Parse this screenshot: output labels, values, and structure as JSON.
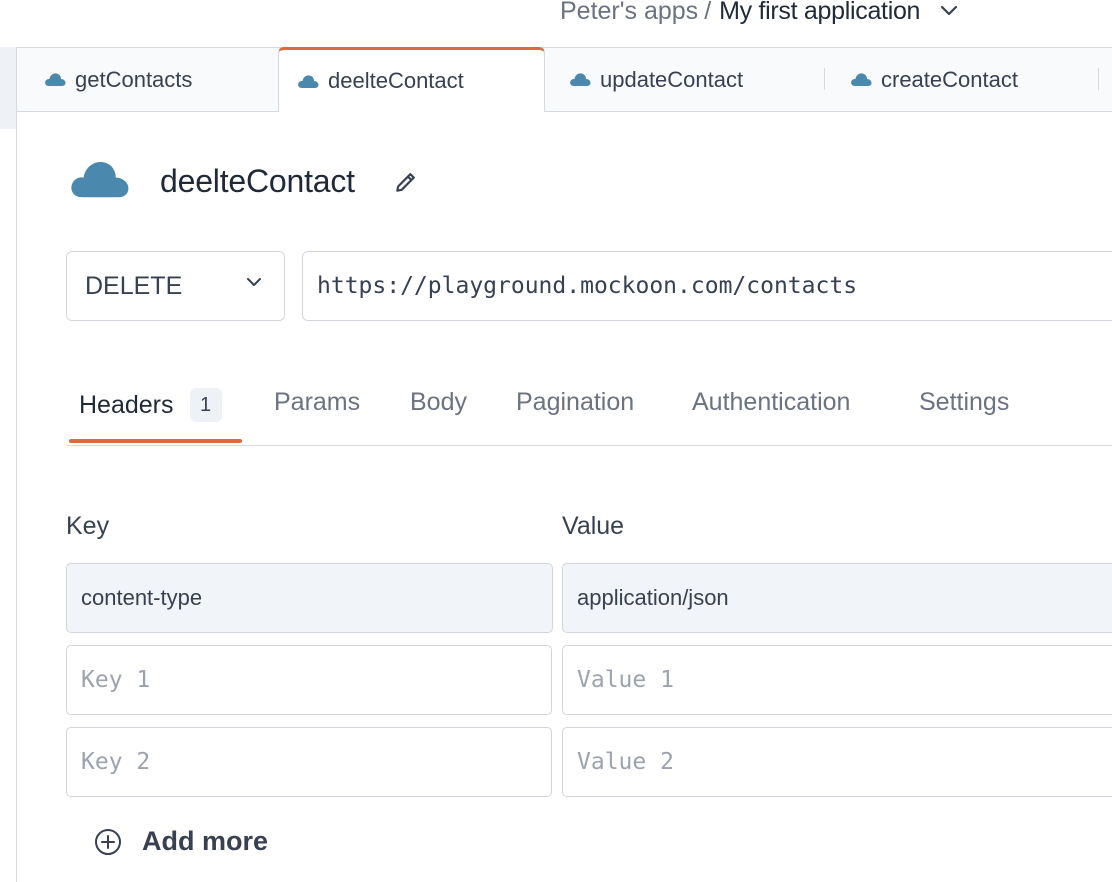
{
  "breadcrumb": {
    "root": "Peter's apps",
    "separator": "/",
    "app": "My first application",
    "dropdown_icon": "chevron-down-icon"
  },
  "tabs": [
    {
      "label": "getContacts",
      "icon": "cloud-icon",
      "active": false
    },
    {
      "label": "deelteContact",
      "icon": "cloud-icon",
      "active": true
    },
    {
      "label": "updateContact",
      "icon": "cloud-icon",
      "active": false
    },
    {
      "label": "createContact",
      "icon": "cloud-icon",
      "active": false
    }
  ],
  "endpoint": {
    "name": "deelteContact",
    "icon": "cloud-icon",
    "edit_icon": "pencil-icon",
    "method": "DELETE",
    "url": "https://playground.mockoon.com/contacts"
  },
  "sub_tabs": [
    {
      "label": "Headers",
      "badge": "1",
      "active": true
    },
    {
      "label": "Params",
      "active": false
    },
    {
      "label": "Body",
      "active": false
    },
    {
      "label": "Pagination",
      "active": false
    },
    {
      "label": "Authentication",
      "active": false
    },
    {
      "label": "Settings",
      "active": false
    }
  ],
  "headers_table": {
    "key_label": "Key",
    "value_label": "Value",
    "rows": [
      {
        "key": "content-type",
        "value": "application/json"
      },
      {
        "key_placeholder": "Key 1",
        "value_placeholder": "Value 1"
      },
      {
        "key_placeholder": "Key 2",
        "value_placeholder": "Value 2"
      }
    ],
    "add_more_label": "Add more",
    "add_more_icon": "plus-circle-icon"
  },
  "colors": {
    "accent": "#dd6a3c",
    "cloud": "#4a88ad",
    "border": "#d1d5db",
    "filled_field_bg": "#f1f4f8"
  }
}
